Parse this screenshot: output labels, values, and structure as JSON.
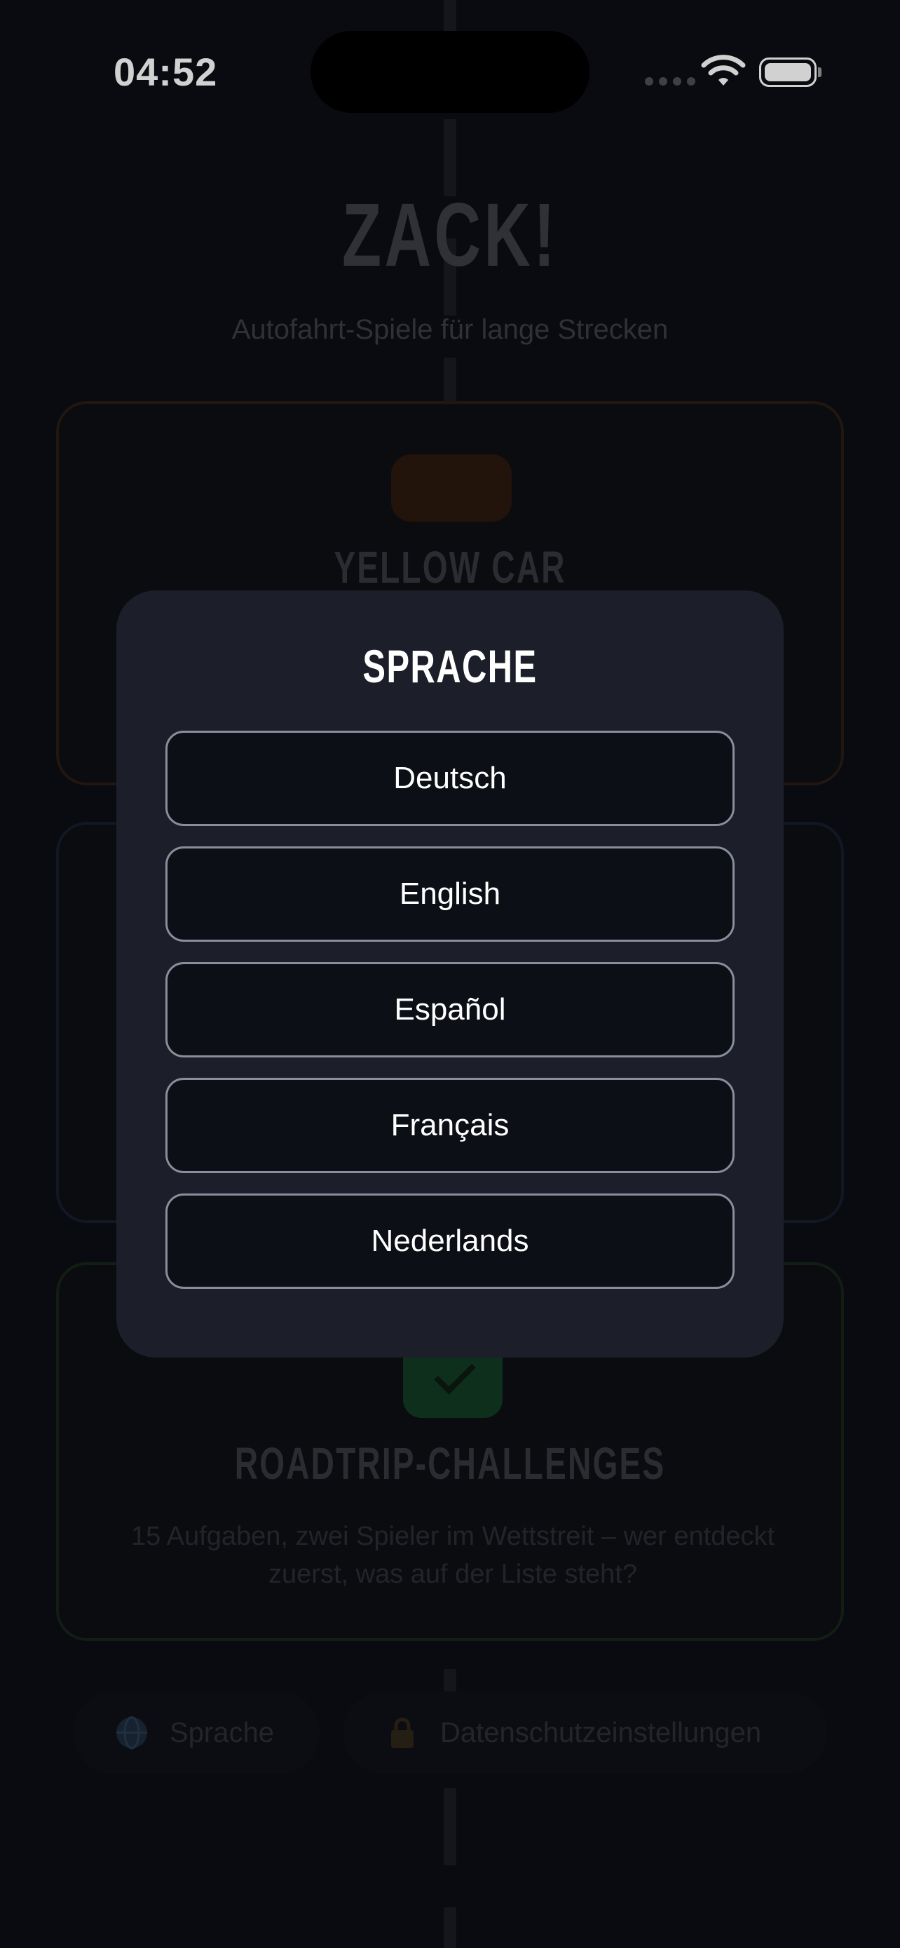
{
  "status_bar": {
    "time": "04:52"
  },
  "app": {
    "title": "ZACK!",
    "subtitle": "Autofahrt-Spiele für lange Strecken",
    "cards": [
      {
        "title": "YELLOW CAR",
        "description": ""
      },
      {
        "title": "",
        "description": ""
      },
      {
        "title": "ROADTRIP-CHALLENGES",
        "description": "15 Aufgaben, zwei Spieler im Wettstreit – wer entdeckt zuerst, was auf der Liste steht?"
      }
    ],
    "footer": {
      "language_label": "Sprache",
      "privacy_label": "Datenschutzeinstellungen"
    }
  },
  "modal": {
    "title": "SPRACHE",
    "options": [
      "Deutsch",
      "English",
      "Español",
      "Français",
      "Nederlands"
    ]
  },
  "colors": {
    "accent_white": "#ffffff",
    "modal_bg": "#1c1f2a",
    "button_border": "#8a8e9c"
  },
  "icons": [
    "wifi-icon",
    "battery-icon",
    "globe-icon",
    "lock-icon",
    "check-icon"
  ]
}
